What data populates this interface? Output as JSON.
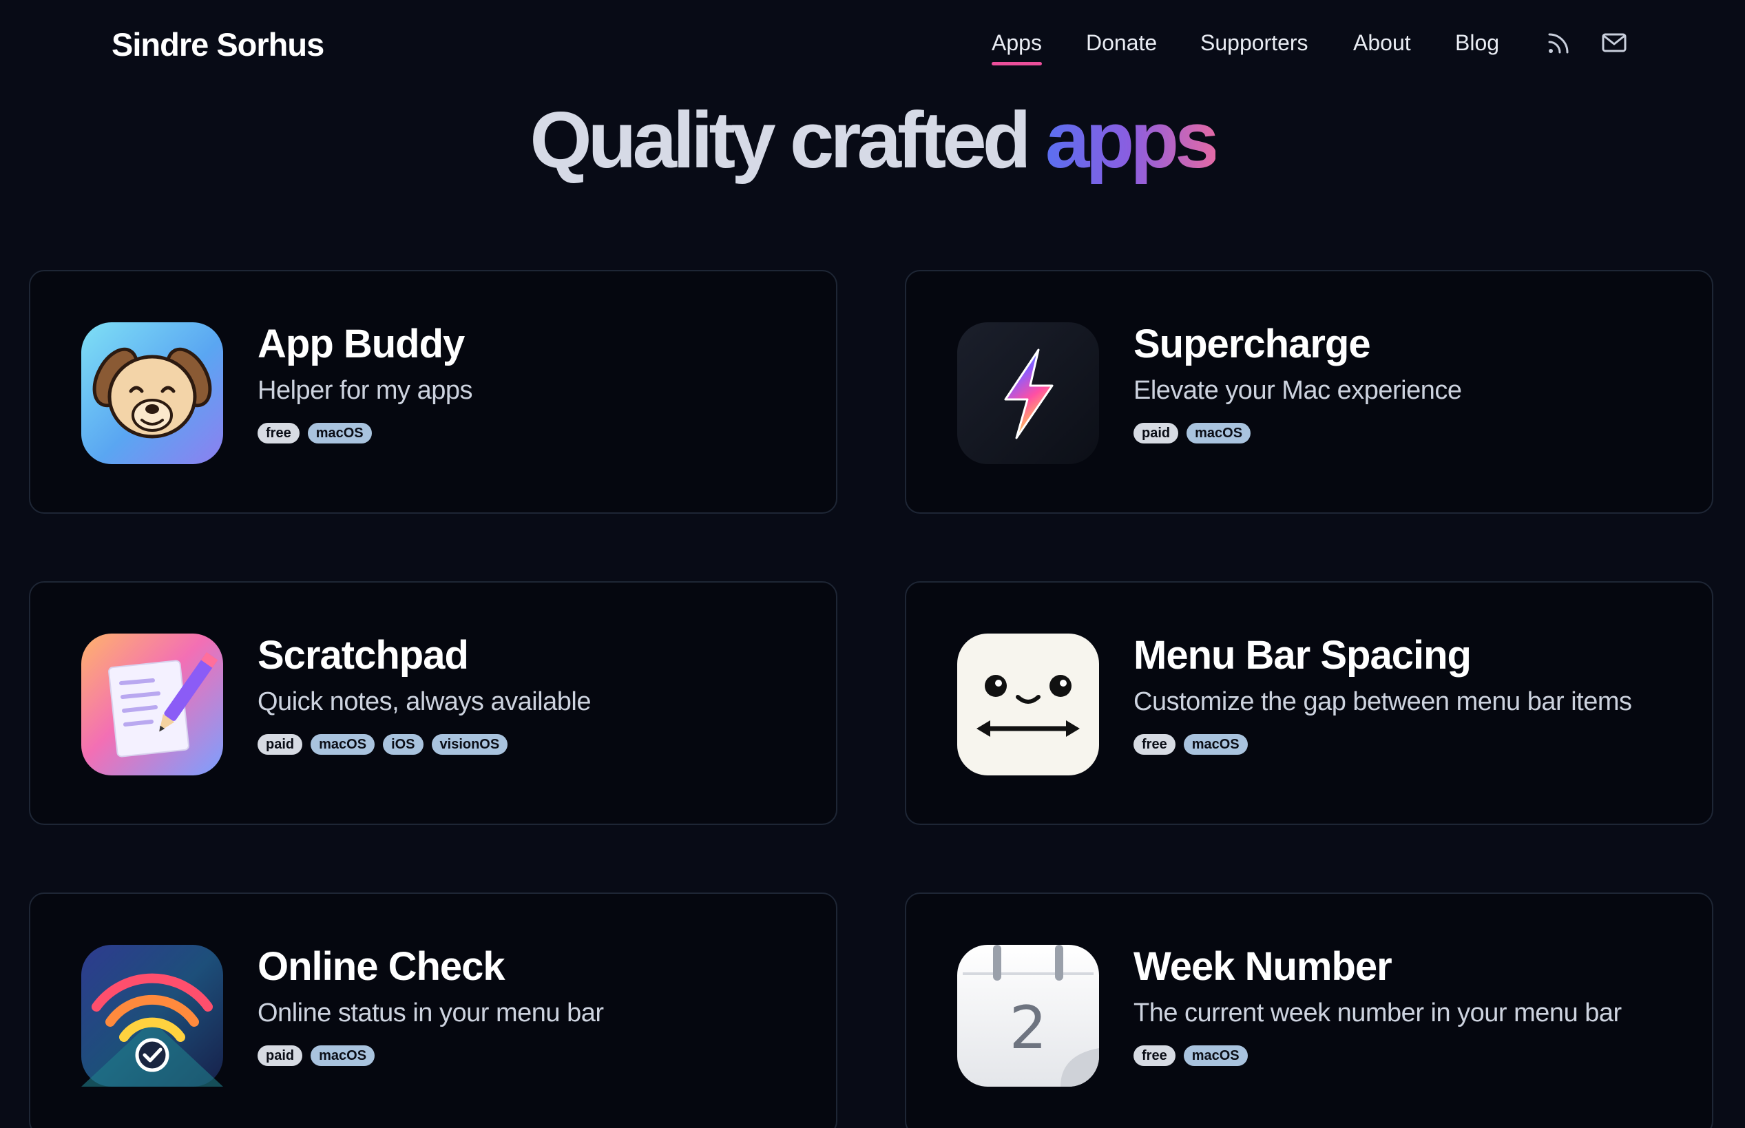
{
  "header": {
    "brand": "Sindre Sorhus",
    "nav": [
      {
        "label": "Apps",
        "active": true
      },
      {
        "label": "Donate",
        "active": false
      },
      {
        "label": "Supporters",
        "active": false
      },
      {
        "label": "About",
        "active": false
      },
      {
        "label": "Blog",
        "active": false
      }
    ],
    "icons": [
      "rss-icon",
      "mail-icon"
    ]
  },
  "hero": {
    "title_main": "Quality crafted",
    "title_accent": "apps"
  },
  "colors": {
    "background": "#080b16",
    "card_border": "#1e2635",
    "nav_active_underline": "#ec4f9b",
    "accent_gradient_start": "#5b6ff0",
    "accent_gradient_end": "#e36aa6",
    "tag_kind_bg": "#d7dbe3",
    "tag_platform_bg": "#a9c3de"
  },
  "apps": [
    {
      "name": "App Buddy",
      "description": "Helper for my apps",
      "tags": [
        "free",
        "macOS"
      ],
      "icon": "dog-face-icon"
    },
    {
      "name": "Supercharge",
      "description": "Elevate your Mac experience",
      "tags": [
        "paid",
        "macOS"
      ],
      "icon": "lightning-bolt-icon"
    },
    {
      "name": "Scratchpad",
      "description": "Quick notes, always available",
      "tags": [
        "paid",
        "macOS",
        "iOS",
        "visionOS"
      ],
      "icon": "notepad-pencil-icon"
    },
    {
      "name": "Menu Bar Spacing",
      "description": "Customize the gap between menu bar items",
      "tags": [
        "free",
        "macOS"
      ],
      "icon": "spacing-face-icon"
    },
    {
      "name": "Online Check",
      "description": "Online status in your menu bar",
      "tags": [
        "paid",
        "macOS"
      ],
      "icon": "wifi-check-icon"
    },
    {
      "name": "Week Number",
      "description": "The current week number in your menu bar",
      "tags": [
        "free",
        "macOS"
      ],
      "icon": "calendar-icon"
    }
  ]
}
